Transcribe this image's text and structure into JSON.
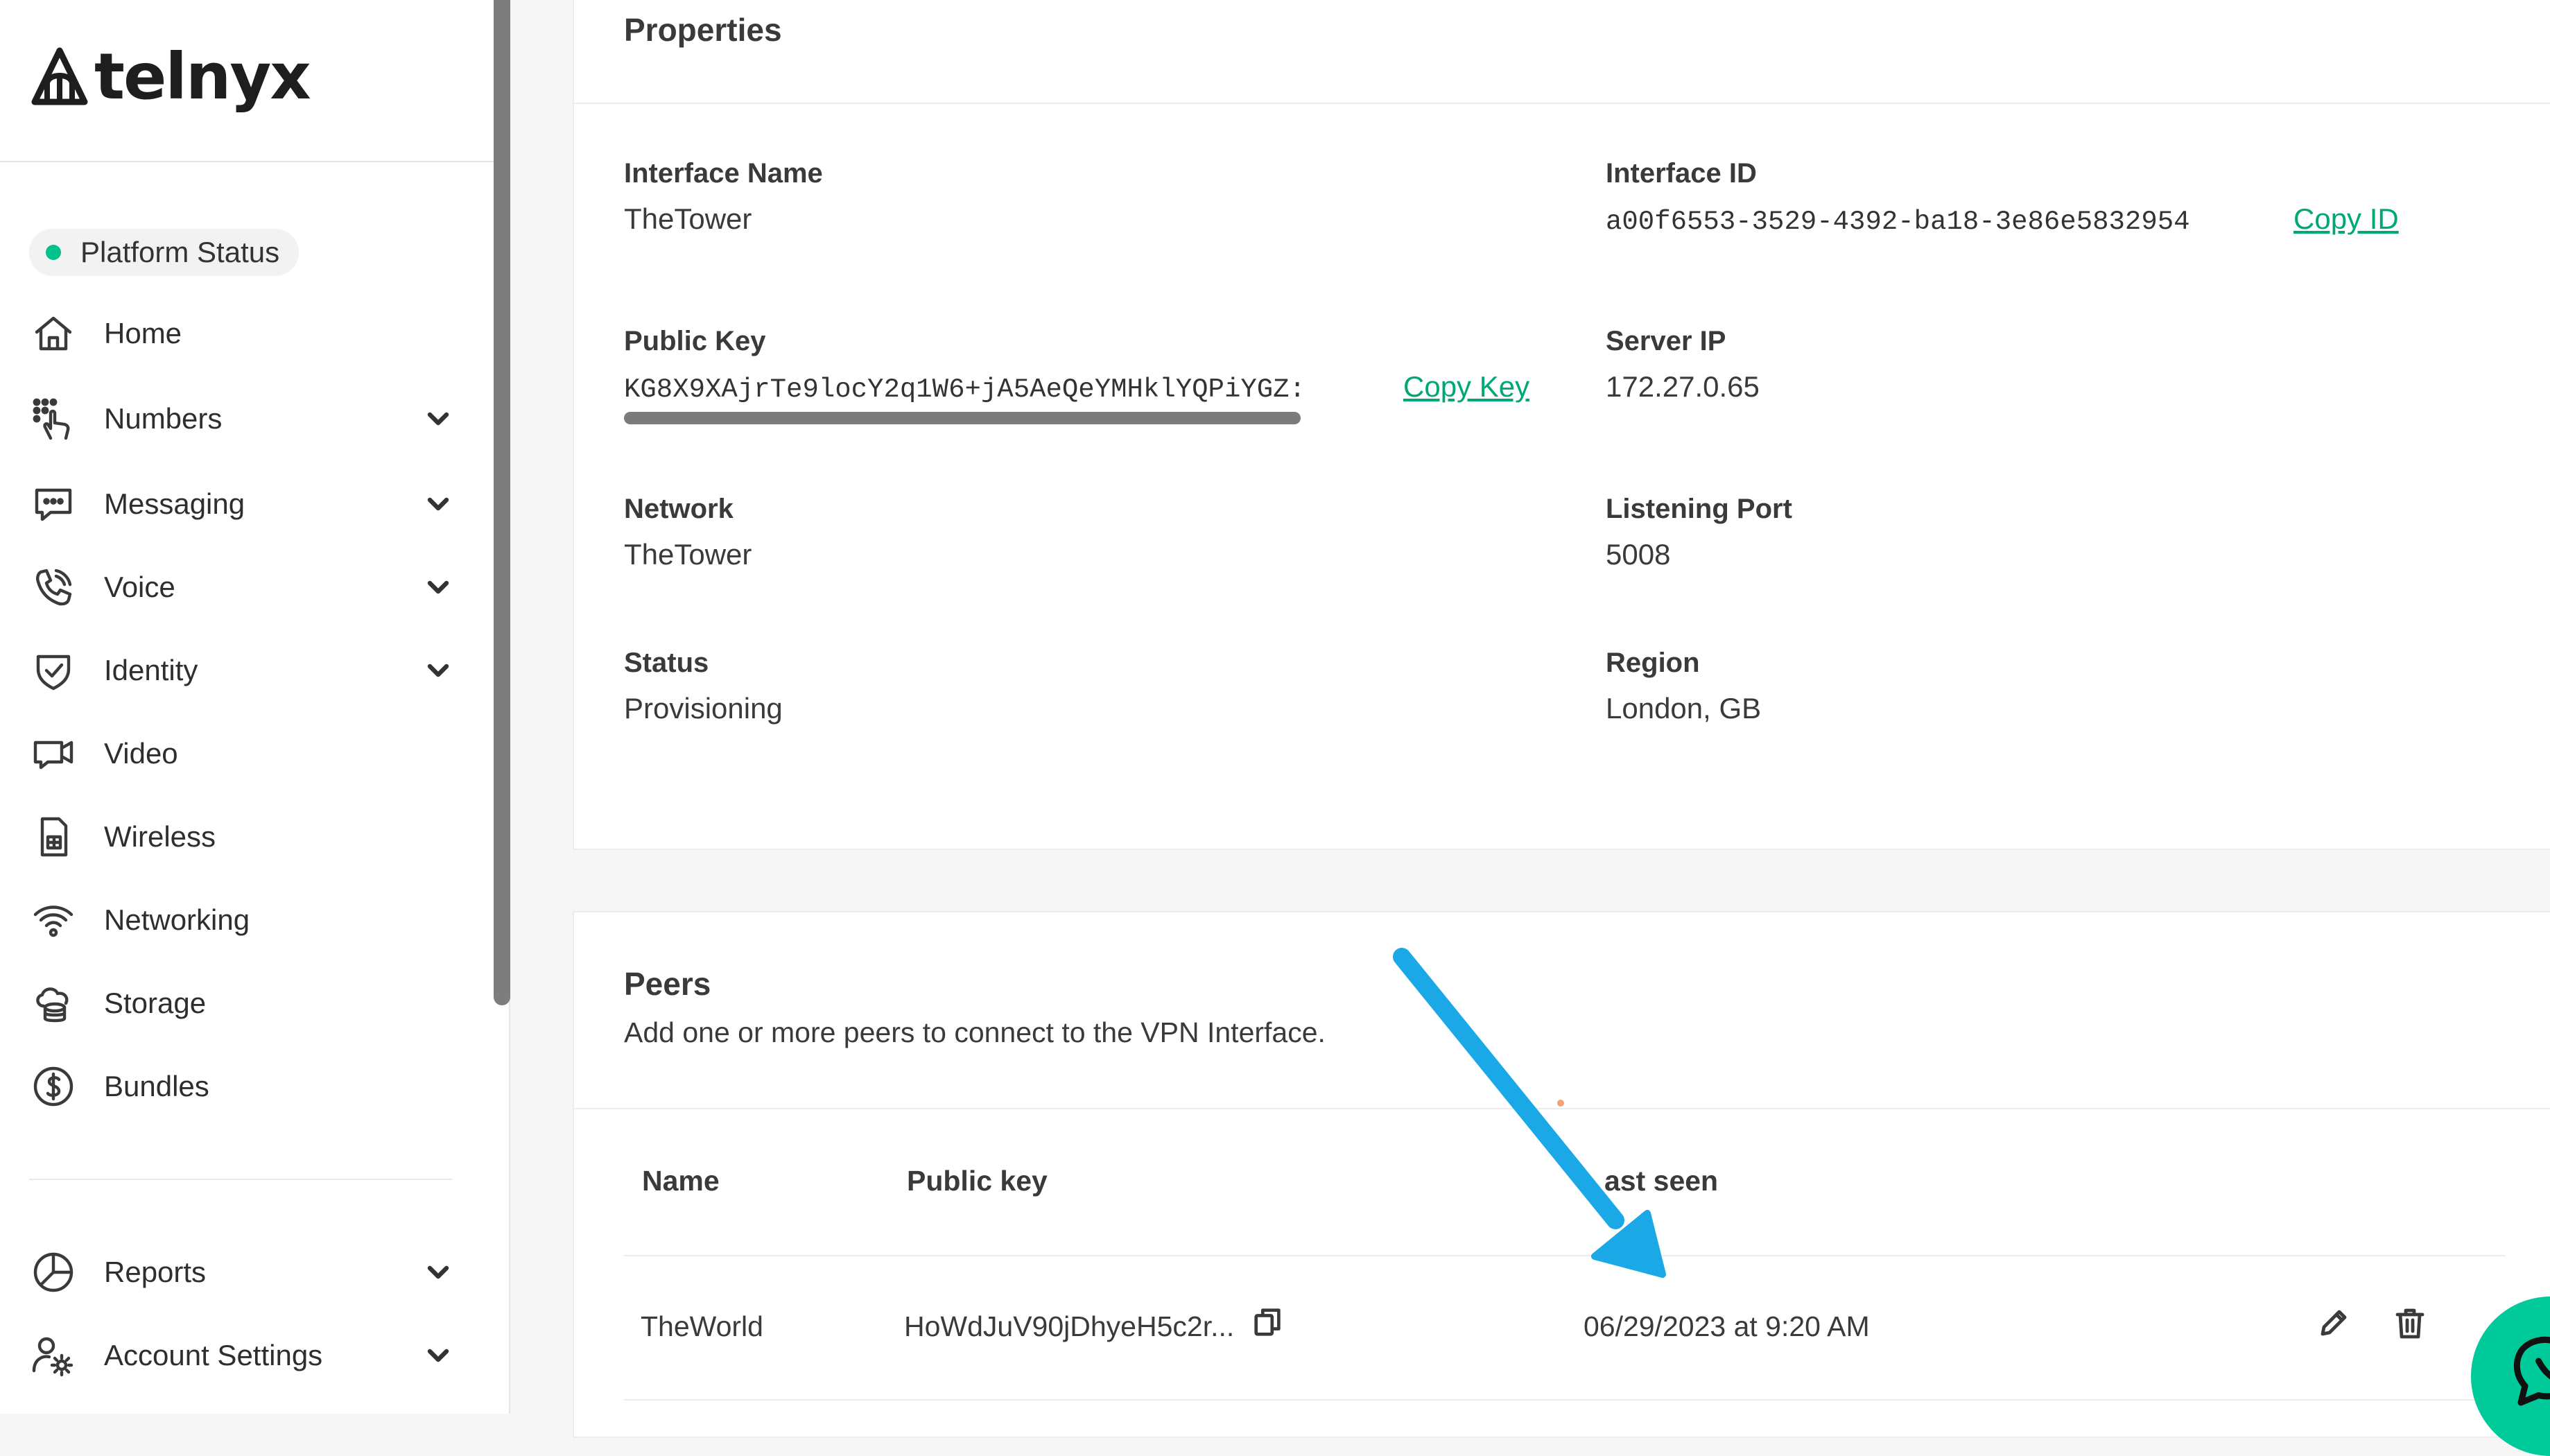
{
  "brand": {
    "name": "telnyx",
    "accent": "#00c08b",
    "link_color": "#00a878"
  },
  "sidebar": {
    "platform_status": "Platform Status",
    "items": [
      {
        "label": "Home",
        "icon": "home-icon",
        "expandable": false
      },
      {
        "label": "Numbers",
        "icon": "dialpad-icon",
        "expandable": true
      },
      {
        "label": "Messaging",
        "icon": "message-icon",
        "expandable": true
      },
      {
        "label": "Voice",
        "icon": "phone-icon",
        "expandable": true
      },
      {
        "label": "Identity",
        "icon": "shield-check-icon",
        "expandable": true
      },
      {
        "label": "Video",
        "icon": "video-icon",
        "expandable": false
      },
      {
        "label": "Wireless",
        "icon": "sim-card-icon",
        "expandable": false
      },
      {
        "label": "Networking",
        "icon": "wifi-icon",
        "expandable": false
      },
      {
        "label": "Storage",
        "icon": "cloud-storage-icon",
        "expandable": false
      },
      {
        "label": "Bundles",
        "icon": "dollar-circle-icon",
        "expandable": false
      },
      {
        "label": "Reports",
        "icon": "pie-chart-icon",
        "expandable": true
      },
      {
        "label": "Account Settings",
        "icon": "user-gear-icon",
        "expandable": true
      }
    ]
  },
  "properties": {
    "title": "Properties",
    "interface_name_label": "Interface Name",
    "interface_name": "TheTower",
    "interface_id_label": "Interface ID",
    "interface_id": "a00f6553-3529-4392-ba18-3e86e5832954",
    "copy_id": "Copy ID",
    "public_key_label": "Public Key",
    "public_key": "KG8X9XAjrTe9locY2q1W6+jA5AeQeYMHklYQPiYGZ:",
    "copy_key": "Copy Key",
    "server_ip_label": "Server IP",
    "server_ip": "172.27.0.65",
    "network_label": "Network",
    "network": "TheTower",
    "listening_port_label": "Listening Port",
    "listening_port": "5008",
    "status_label": "Status",
    "status": "Provisioning",
    "region_label": "Region",
    "region": "London, GB"
  },
  "peers": {
    "title": "Peers",
    "subtitle": "Add one or more peers to connect to the VPN Interface.",
    "columns": {
      "name": "Name",
      "public_key": "Public key",
      "last_seen": "ast seen"
    },
    "rows": [
      {
        "name": "TheWorld",
        "public_key": "HoWdJuV90jDhyeH5c2r...",
        "last_seen": "06/29/2023 at 9:20 AM"
      }
    ]
  },
  "annotation": {
    "arrow_color": "#1aa9e6"
  }
}
